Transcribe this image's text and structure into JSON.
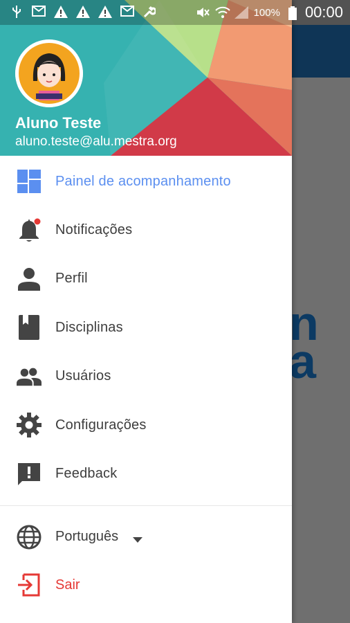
{
  "status_bar": {
    "battery": "100%",
    "time": "00:00",
    "icons": [
      "usb-icon",
      "mail-icon",
      "warning-icon",
      "warning-icon",
      "warning-icon",
      "mail-icon",
      "wrench-icon",
      "mute-icon",
      "wifi-icon",
      "signal-icon",
      "battery-icon"
    ]
  },
  "drawer": {
    "user": {
      "name": "Aluno Teste",
      "email": "aluno.teste@alu.mestra.org"
    },
    "menu": [
      {
        "label": "Painel de acompanhamento",
        "icon": "dashboard-icon",
        "active": true
      },
      {
        "label": "Notificações",
        "icon": "bell-icon",
        "badge": true
      },
      {
        "label": "Perfil",
        "icon": "person-icon"
      },
      {
        "label": "Disciplinas",
        "icon": "book-icon"
      },
      {
        "label": "Usuários",
        "icon": "people-icon"
      },
      {
        "label": "Configurações",
        "icon": "gear-icon"
      },
      {
        "label": "Feedback",
        "icon": "feedback-icon"
      }
    ],
    "language": {
      "label": "Português",
      "icon": "globe-icon"
    },
    "logout": {
      "label": "Sair",
      "icon": "logout-icon"
    }
  },
  "colors": {
    "active": "#5b8ff0",
    "logout": "#e53935",
    "header_teal": "#39b8b5",
    "header_red": "#d13a48",
    "app_bar": "#0f3556"
  }
}
